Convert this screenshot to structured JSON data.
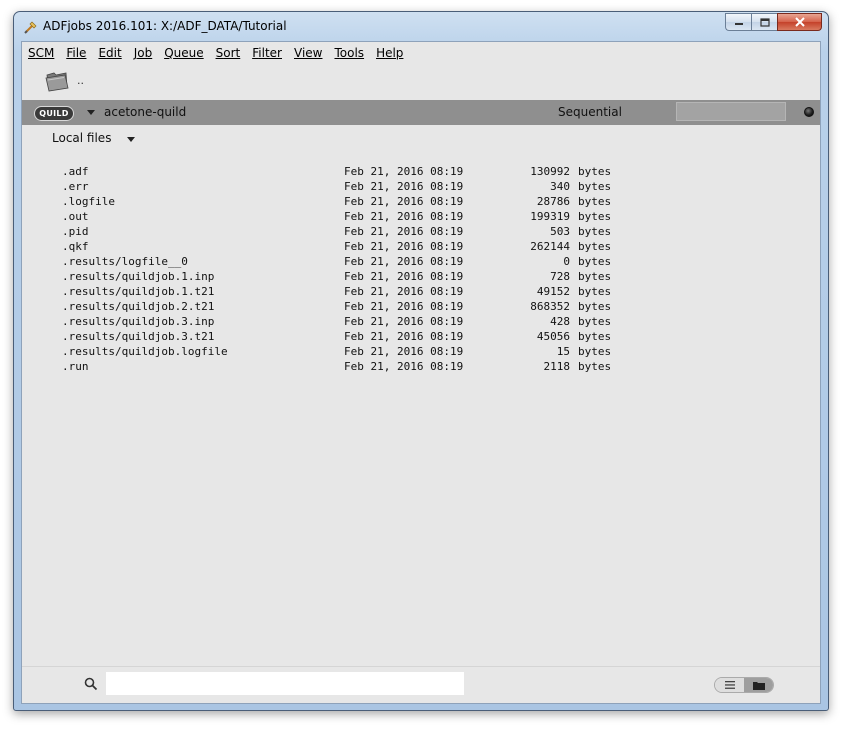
{
  "window": {
    "title": "ADFjobs 2016.101: X:/ADF_DATA/Tutorial"
  },
  "menubar": {
    "items": [
      {
        "label": "SCM"
      },
      {
        "label": "File"
      },
      {
        "label": "Edit"
      },
      {
        "label": "Job"
      },
      {
        "label": "Queue"
      },
      {
        "label": "Sort"
      },
      {
        "label": "Filter"
      },
      {
        "label": "View"
      },
      {
        "label": "Tools"
      },
      {
        "label": "Help"
      }
    ]
  },
  "toolbar": {
    "up_label": ".."
  },
  "jobbar": {
    "badge": "QUILD",
    "job_name": "acetone-quild",
    "queue_mode": "Sequential"
  },
  "files": {
    "header": "Local files",
    "rows": [
      {
        "name": ".adf",
        "date": "Feb 21, 2016 08:19",
        "size": "130992",
        "unit": "bytes"
      },
      {
        "name": ".err",
        "date": "Feb 21, 2016 08:19",
        "size": "340",
        "unit": "bytes"
      },
      {
        "name": ".logfile",
        "date": "Feb 21, 2016 08:19",
        "size": "28786",
        "unit": "bytes"
      },
      {
        "name": ".out",
        "date": "Feb 21, 2016 08:19",
        "size": "199319",
        "unit": "bytes"
      },
      {
        "name": ".pid",
        "date": "Feb 21, 2016 08:19",
        "size": "503",
        "unit": "bytes"
      },
      {
        "name": ".qkf",
        "date": "Feb 21, 2016 08:19",
        "size": "262144",
        "unit": "bytes"
      },
      {
        "name": ".results/logfile__0",
        "date": "Feb 21, 2016 08:19",
        "size": "0",
        "unit": "bytes"
      },
      {
        "name": ".results/quildjob.1.inp",
        "date": "Feb 21, 2016 08:19",
        "size": "728",
        "unit": "bytes"
      },
      {
        "name": ".results/quildjob.1.t21",
        "date": "Feb 21, 2016 08:19",
        "size": "49152",
        "unit": "bytes"
      },
      {
        "name": ".results/quildjob.2.t21",
        "date": "Feb 21, 2016 08:19",
        "size": "868352",
        "unit": "bytes"
      },
      {
        "name": ".results/quildjob.3.inp",
        "date": "Feb 21, 2016 08:19",
        "size": "428",
        "unit": "bytes"
      },
      {
        "name": ".results/quildjob.3.t21",
        "date": "Feb 21, 2016 08:19",
        "size": "45056",
        "unit": "bytes"
      },
      {
        "name": ".results/quildjob.logfile",
        "date": "Feb 21, 2016 08:19",
        "size": "15",
        "unit": "bytes"
      },
      {
        "name": ".run",
        "date": "Feb 21, 2016 08:19",
        "size": "2118",
        "unit": "bytes"
      }
    ]
  },
  "search": {
    "value": "",
    "placeholder": ""
  },
  "icons": {
    "app": "adf-tool-icon",
    "folder": "folder-icon",
    "search": "search-icon",
    "list_view": "list-view-icon",
    "folder_view": "folder-view-icon",
    "status": "status-led-icon"
  },
  "colors": {
    "jobbar_bg": "#8f8f8f",
    "client_bg": "#e7e7e7",
    "badge_bg": "#3a3a3a",
    "close_btn": "#c4412a"
  }
}
